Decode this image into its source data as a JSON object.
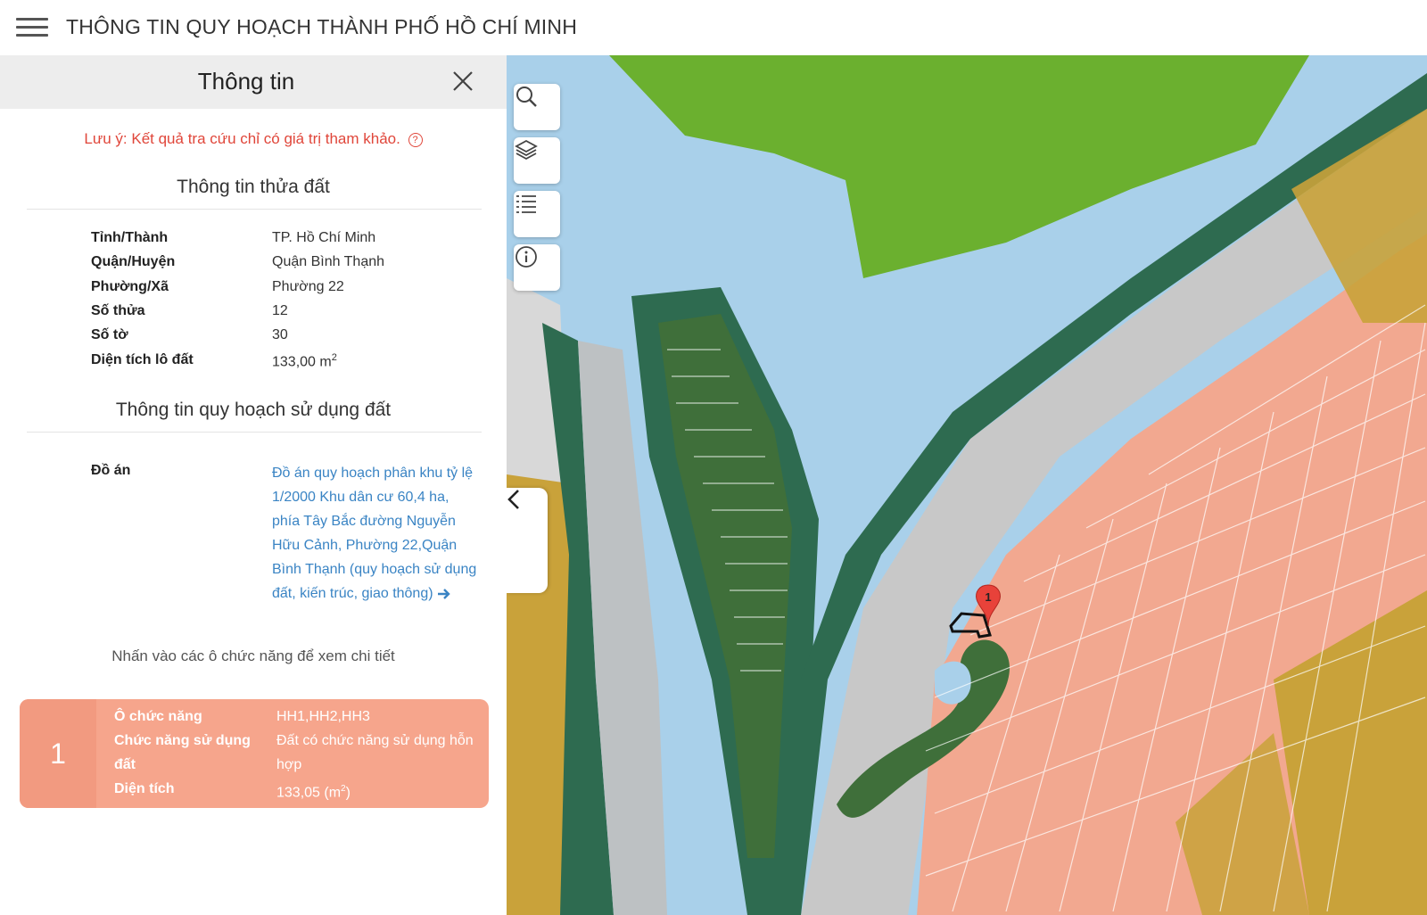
{
  "header": {
    "title": "THÔNG TIN QUY HOẠCH THÀNH PHỐ HỒ CHÍ MINH"
  },
  "panel": {
    "title": "Thông tin",
    "notice": "Lưu ý: Kết quả tra cứu chỉ có giá trị tham khảo.",
    "help_icon_glyph": "?",
    "parcel_section_title": "Thông tin thửa đất",
    "parcel": [
      {
        "label": "Tỉnh/Thành",
        "value": "TP. Hồ Chí Minh"
      },
      {
        "label": "Quận/Huyện",
        "value": "Quận Bình Thạnh"
      },
      {
        "label": "Phường/Xã",
        "value": "Phường 22"
      },
      {
        "label": "Số thửa",
        "value": "12"
      },
      {
        "label": "Số tờ",
        "value": "30"
      },
      {
        "label": "Diện tích lô đất",
        "value": "133,00 m",
        "unit_sup": "2"
      }
    ],
    "planning_section_title": "Thông tin quy hoạch sử dụng đất",
    "plan_label": "Đồ án",
    "plan_link": "Đồ án quy hoạch phân khu tỷ lệ 1/2000 Khu dân cư 60,4 ha, phía Tây Bắc đường Nguyễn Hữu Cảnh, Phường 22,Quận Bình Thạnh (quy hoạch sử dụng đất, kiến trúc, giao thông)",
    "hint": "Nhấn vào các ô chức năng để xem chi tiết",
    "function_card": {
      "number": "1",
      "rows": [
        {
          "label": "Ô chức năng",
          "value": "HH1,HH2,HH3"
        },
        {
          "label": "Chức năng sử dụng đất",
          "value": "Đất có chức năng sử dụng hỗn hợp"
        },
        {
          "label": "Diện tích",
          "value": "133,05 (m",
          "unit_sup": "2",
          "suffix": ")"
        }
      ],
      "color": "#f6a58c"
    }
  },
  "map": {
    "marker_label": "1",
    "tools": [
      "search-icon",
      "layers-icon",
      "list-icon",
      "info-icon"
    ],
    "colors": {
      "water": "#a9d0ea",
      "green": "#6bb02f",
      "dark_green": "#2e6b50",
      "residential": "#f2a890",
      "yellow": "#c9a23a",
      "road": "#c8c8c8"
    }
  }
}
